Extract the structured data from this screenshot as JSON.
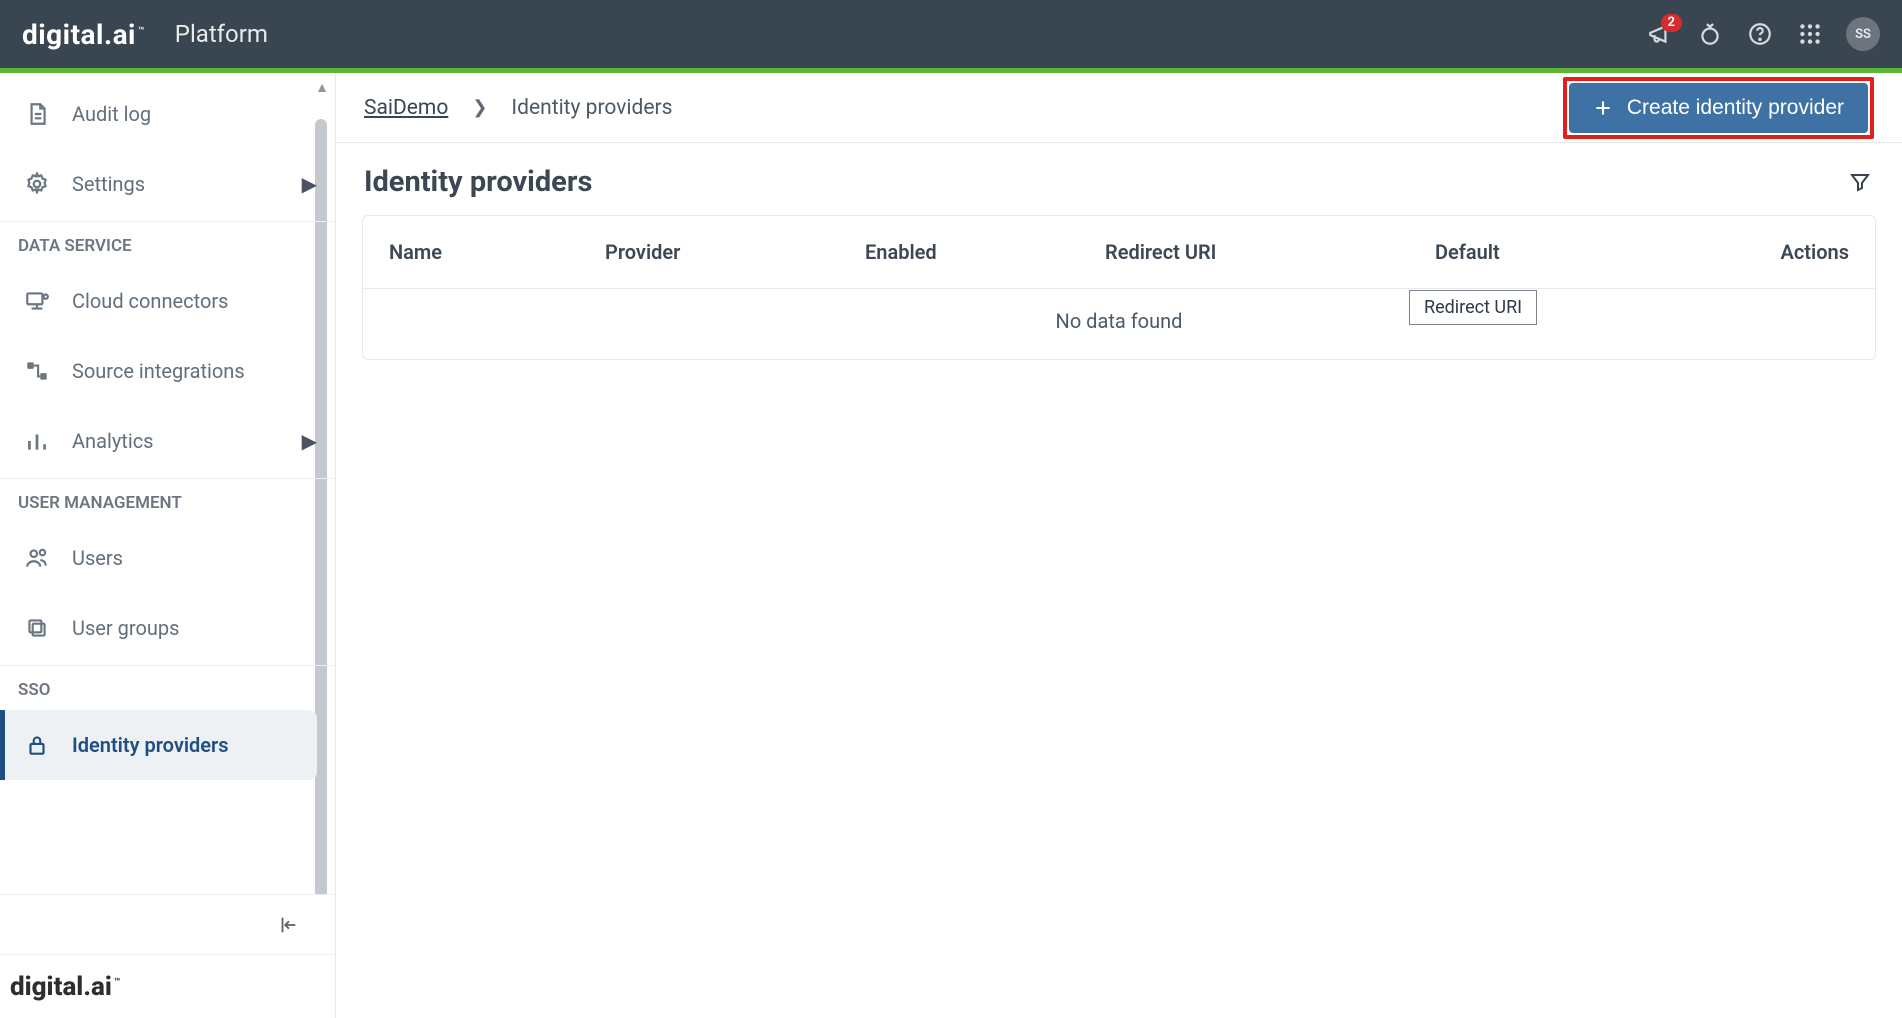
{
  "header": {
    "logo_text": "digital.ai",
    "tm": "™",
    "product": "Platform",
    "notification_count": "2",
    "avatar_initials": "SS"
  },
  "sidebar": {
    "items_top": [
      {
        "id": "audit-log",
        "label": "Audit log"
      },
      {
        "id": "settings",
        "label": "Settings",
        "expandable": true
      }
    ],
    "section_data_service": "DATA SERVICE",
    "items_data": [
      {
        "id": "cloud-connectors",
        "label": "Cloud connectors"
      },
      {
        "id": "source-integrations",
        "label": "Source integrations"
      },
      {
        "id": "analytics",
        "label": "Analytics",
        "expandable": true
      }
    ],
    "section_user_mgmt": "USER MANAGEMENT",
    "items_user": [
      {
        "id": "users",
        "label": "Users"
      },
      {
        "id": "user-groups",
        "label": "User groups"
      }
    ],
    "section_sso": "SSO",
    "items_sso": [
      {
        "id": "identity-providers",
        "label": "Identity providers",
        "active": true
      }
    ],
    "footer_logo": "digital.ai",
    "footer_tm": "™"
  },
  "breadcrumb": {
    "root": "SaiDemo",
    "current": "Identity providers"
  },
  "actions": {
    "create_label": "Create identity provider"
  },
  "page": {
    "title": "Identity providers"
  },
  "table": {
    "columns": {
      "name": "Name",
      "provider": "Provider",
      "enabled": "Enabled",
      "redirect_uri": "Redirect URI",
      "default": "Default",
      "actions": "Actions"
    },
    "empty_text": "No data found",
    "rows": []
  },
  "tooltip": {
    "text": "Redirect URI"
  }
}
